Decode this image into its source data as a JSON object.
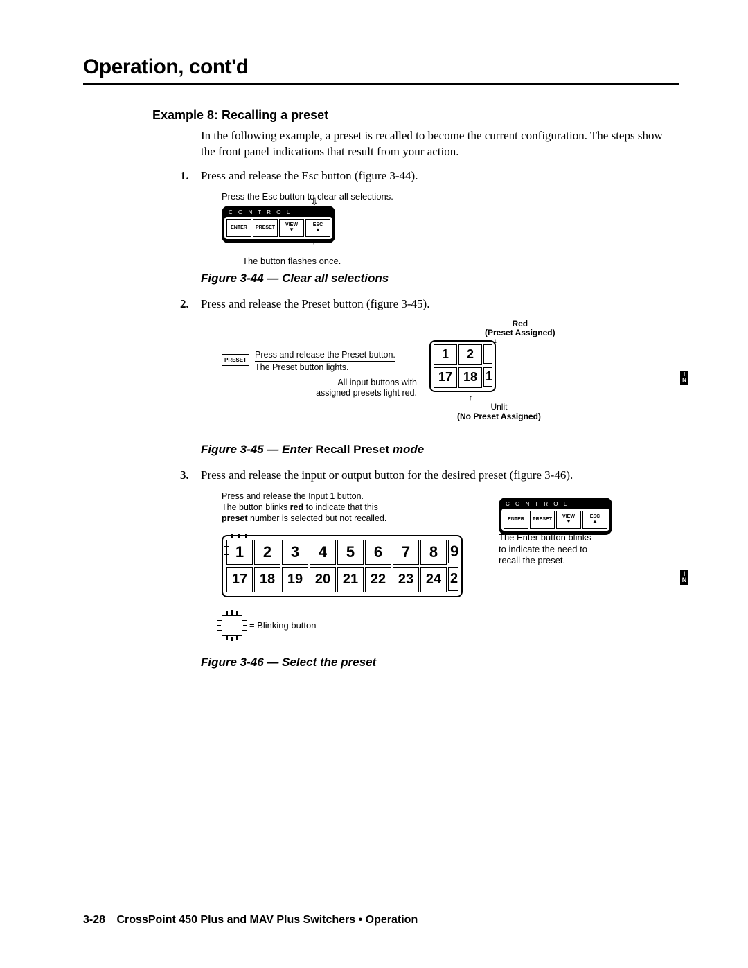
{
  "chapter_title": "Operation, cont'd",
  "example_heading": "Example 8: Recalling a preset",
  "intro_para": "In the following example, a preset is recalled to become the current configuration. The steps show the front panel indications that result from your action.",
  "steps": {
    "s1_num": "1.",
    "s1_text": "Press and release the Esc button (figure 3-44).",
    "s2_num": "2.",
    "s2_text": "Press and release the Preset button (figure 3-45).",
    "s3_num": "3.",
    "s3_text": "Press and release the input or output button for the desired preset (figure 3-46)."
  },
  "fig44": {
    "top_note": "Press the Esc button to clear all selections.",
    "control_label": "C O N T R O L",
    "btn_enter": "ENTER",
    "btn_preset": "PRESET",
    "btn_view": "VIEW",
    "btn_esc": "ESC",
    "bottom_note": "The button flashes once.",
    "caption": "Figure 3-44 — Clear all selections"
  },
  "fig45": {
    "red_label": "Red",
    "red_sub": "(Preset Assigned)",
    "preset_btn": "PRESET",
    "note1_line1": "Press and release the Preset button.",
    "note1_line2": "The Preset button lights.",
    "note2_line1": "All input buttons with",
    "note2_line2": "assigned presets light red.",
    "btn_1": "1",
    "btn_2": "2",
    "btn_17": "17",
    "btn_18": "18",
    "btn_19cut": "1",
    "in_label": "I\nN",
    "unlit": "Unlit",
    "unlit_sub": "(No Preset Assigned)",
    "caption_pre": "Figure 3-45 — ",
    "caption_em1": "Enter",
    "caption_mid": " Recall Preset ",
    "caption_em2": "mode"
  },
  "fig46": {
    "note_l1": "Press and release the Input 1 button.",
    "note_l2a": "The button blinks ",
    "note_l2b": "red",
    "note_l2c": " to indicate that this",
    "note_l3a": "preset",
    "note_l3b": " number is selected but not recalled.",
    "row1": [
      "1",
      "2",
      "3",
      "4",
      "5",
      "6",
      "7",
      "8"
    ],
    "row1_cut": "9",
    "row2": [
      "17",
      "18",
      "19",
      "20",
      "21",
      "22",
      "23",
      "24"
    ],
    "row2_cut": "2",
    "in_label": "I\nN",
    "control_label": "C O N T R O L",
    "btn_enter": "ENTER",
    "btn_preset": "PRESET",
    "btn_view": "VIEW",
    "btn_esc": "ESC",
    "ctrl_note_l1": "The Enter button blinks",
    "ctrl_note_l2": "to indicate the need to",
    "ctrl_note_l3": "recall the preset.",
    "legend": "= Blinking button",
    "caption": "Figure 3-46 — Select the preset"
  },
  "footer": {
    "page": "3-28",
    "text": "CrossPoint 450 Plus and MAV Plus Switchers • Operation"
  }
}
